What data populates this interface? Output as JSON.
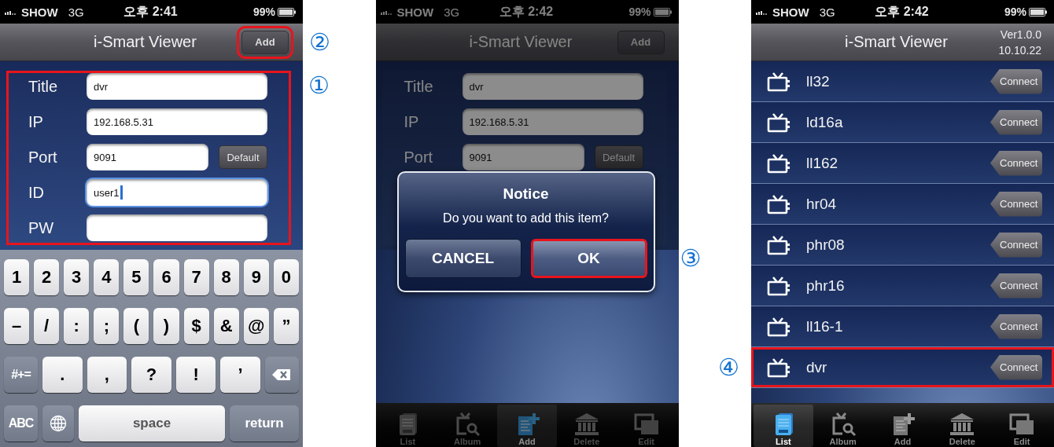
{
  "screens": [
    {
      "status_bar": {
        "carrier": "SHOW",
        "network": "3G",
        "time": "오후 2:41",
        "battery": "99%"
      },
      "nav": {
        "title": "i-Smart Viewer",
        "button": {
          "label": "Add",
          "highlighted": true,
          "callout": "②"
        }
      },
      "form": {
        "highlighted": true,
        "callout": "①",
        "fields": [
          {
            "label": "Title",
            "value": "dvr",
            "focused": false
          },
          {
            "label": "IP",
            "value": "192.168.5.31",
            "focused": false
          },
          {
            "label": "Port",
            "value": "9091",
            "focused": false,
            "button": "Default"
          },
          {
            "label": "ID",
            "value": "user1",
            "focused": true
          },
          {
            "label": "PW",
            "focused": false
          }
        ]
      },
      "keyboard": {
        "number_row": [
          {
            "kind": "char",
            "label": "1"
          },
          {
            "kind": "char",
            "label": "2"
          },
          {
            "kind": "char",
            "label": "3"
          },
          {
            "kind": "char",
            "label": "4"
          },
          {
            "kind": "char",
            "label": "5"
          },
          {
            "kind": "char",
            "label": "6"
          },
          {
            "kind": "char",
            "label": "7"
          },
          {
            "kind": "char",
            "label": "8"
          },
          {
            "kind": "char",
            "label": "9"
          },
          {
            "kind": "char",
            "label": "0"
          }
        ],
        "symbol_row": [
          {
            "kind": "char",
            "label": "–"
          },
          {
            "kind": "char",
            "label": "/"
          },
          {
            "kind": "char",
            "label": ":"
          },
          {
            "kind": "char",
            "label": ";"
          },
          {
            "kind": "char",
            "label": "("
          },
          {
            "kind": "char",
            "label": ")"
          },
          {
            "kind": "char",
            "label": "$"
          },
          {
            "kind": "char",
            "label": "&"
          },
          {
            "kind": "char",
            "label": "@"
          },
          {
            "kind": "char",
            "label": "”"
          }
        ],
        "punctuation_row": [
          {
            "kind": "mod",
            "label": "#+="
          },
          {
            "kind": "char",
            "label": "."
          },
          {
            "kind": "char",
            "label": ","
          },
          {
            "kind": "char",
            "label": "?"
          },
          {
            "kind": "char",
            "label": "!"
          },
          {
            "kind": "char",
            "label": "’"
          },
          {
            "kind": "delete"
          }
        ],
        "bottom_row": [
          {
            "kind": "mod",
            "label": "ABC"
          },
          {
            "kind": "globe"
          },
          {
            "kind": "space",
            "label": "space"
          },
          {
            "kind": "return",
            "label": "return"
          }
        ]
      }
    },
    {
      "status_bar": {
        "carrier": "SHOW",
        "network": "3G",
        "time": "오후 2:42",
        "battery": "99%"
      },
      "nav": {
        "title": "i-Smart Viewer",
        "button": {
          "label": "Add",
          "highlighted": false
        }
      },
      "form": {
        "highlighted": false,
        "fields": [
          {
            "label": "Title",
            "value": "dvr"
          },
          {
            "label": "IP",
            "value": "192.168.5.31"
          },
          {
            "label": "Port",
            "value": "9091",
            "button": "Default"
          }
        ]
      },
      "alert": {
        "title": "Notice",
        "message": "Do you want to add this item?",
        "buttons": [
          {
            "label": "CANCEL",
            "highlighted": false
          },
          {
            "label": "OK",
            "highlighted": true,
            "callout": "③"
          }
        ]
      },
      "tab_bar": [
        {
          "label": "List",
          "selected": false
        },
        {
          "label": "Album",
          "selected": false
        },
        {
          "label": "Add",
          "selected": true
        },
        {
          "label": "Delete",
          "selected": false
        },
        {
          "label": "Edit",
          "selected": false
        }
      ]
    },
    {
      "status_bar": {
        "carrier": "SHOW",
        "network": "3G",
        "time": "오후 2:42",
        "battery": "99%"
      },
      "nav": {
        "title": "i-Smart Viewer",
        "version": "Ver1.0.0",
        "date": "10.10.22"
      },
      "list": [
        {
          "name": "ll32",
          "button": "Connect",
          "highlighted": false
        },
        {
          "name": "ld16a",
          "button": "Connect",
          "highlighted": false
        },
        {
          "name": "ll162",
          "button": "Connect",
          "highlighted": false
        },
        {
          "name": "hr04",
          "button": "Connect",
          "highlighted": false
        },
        {
          "name": "phr08",
          "button": "Connect",
          "highlighted": false
        },
        {
          "name": "phr16",
          "button": "Connect",
          "highlighted": false
        },
        {
          "name": "ll16-1",
          "button": "Connect",
          "highlighted": false
        },
        {
          "name": "dvr",
          "button": "Connect",
          "highlighted": true,
          "callout": "④"
        }
      ],
      "tab_bar": [
        {
          "label": "List",
          "selected": true
        },
        {
          "label": "Album",
          "selected": false
        },
        {
          "label": "Add",
          "selected": false
        },
        {
          "label": "Delete",
          "selected": false
        },
        {
          "label": "Edit",
          "selected": false
        }
      ]
    }
  ]
}
